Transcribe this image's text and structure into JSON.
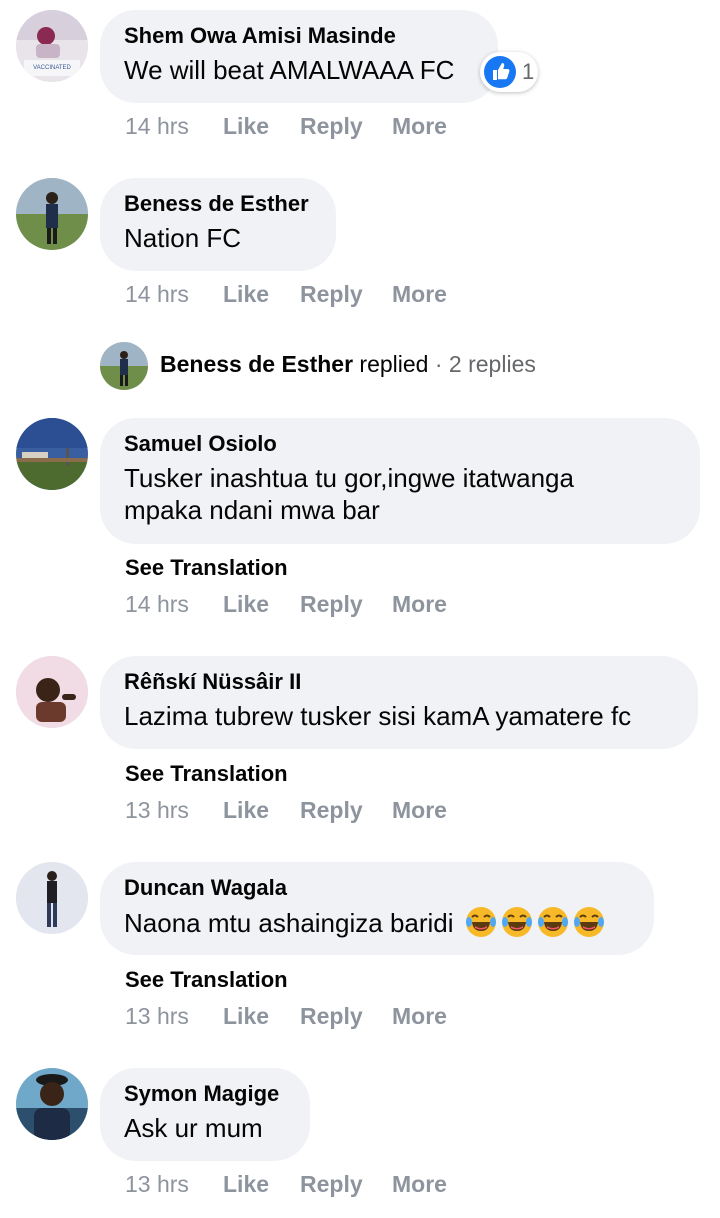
{
  "comments": [
    {
      "author": "Shem Owa Amisi Masinde",
      "text": "We will beat AMALWAAA FC",
      "time": "14 hrs",
      "like": "Like",
      "reply": "Reply",
      "more": "More",
      "reaction_count": "1",
      "avatar_text": "VACCINATED"
    },
    {
      "author": "Beness de Esther",
      "text": "Nation FC",
      "time": "14 hrs",
      "like": "Like",
      "reply": "Reply",
      "more": "More"
    },
    {
      "author": "Samuel Osiolo",
      "text_line1": "Tusker inashtua tu gor,ingwe itatwanga",
      "text_line2": "mpaka ndani mwa bar",
      "see_translation": "See Translation",
      "time": "14 hrs",
      "like": "Like",
      "reply": "Reply",
      "more": "More"
    },
    {
      "author": "Rêñskí Nüssâir II",
      "text": "Lazima tubrew tusker sisi kamA yamatere fc",
      "see_translation": "See Translation",
      "time": "13 hrs",
      "like": "Like",
      "reply": "Reply",
      "more": "More"
    },
    {
      "author": "Duncan Wagala",
      "text": "Naona mtu ashaingiza baridi",
      "emojis": "😂😂😂😂",
      "see_translation": "See Translation",
      "time": "13 hrs",
      "like": "Like",
      "reply": "Reply",
      "more": "More"
    },
    {
      "author": "Symon Magige",
      "text": "Ask ur mum",
      "time": "13 hrs",
      "like": "Like",
      "reply": "Reply",
      "more": "More"
    }
  ],
  "reply_thread": {
    "author": "Beness de Esther",
    "verb": "replied",
    "separator": "·",
    "count": "2 replies"
  },
  "colors": {
    "bubble": "#f0f2f5",
    "action_text": "#8d949e",
    "like_blue": "#1877f2"
  }
}
